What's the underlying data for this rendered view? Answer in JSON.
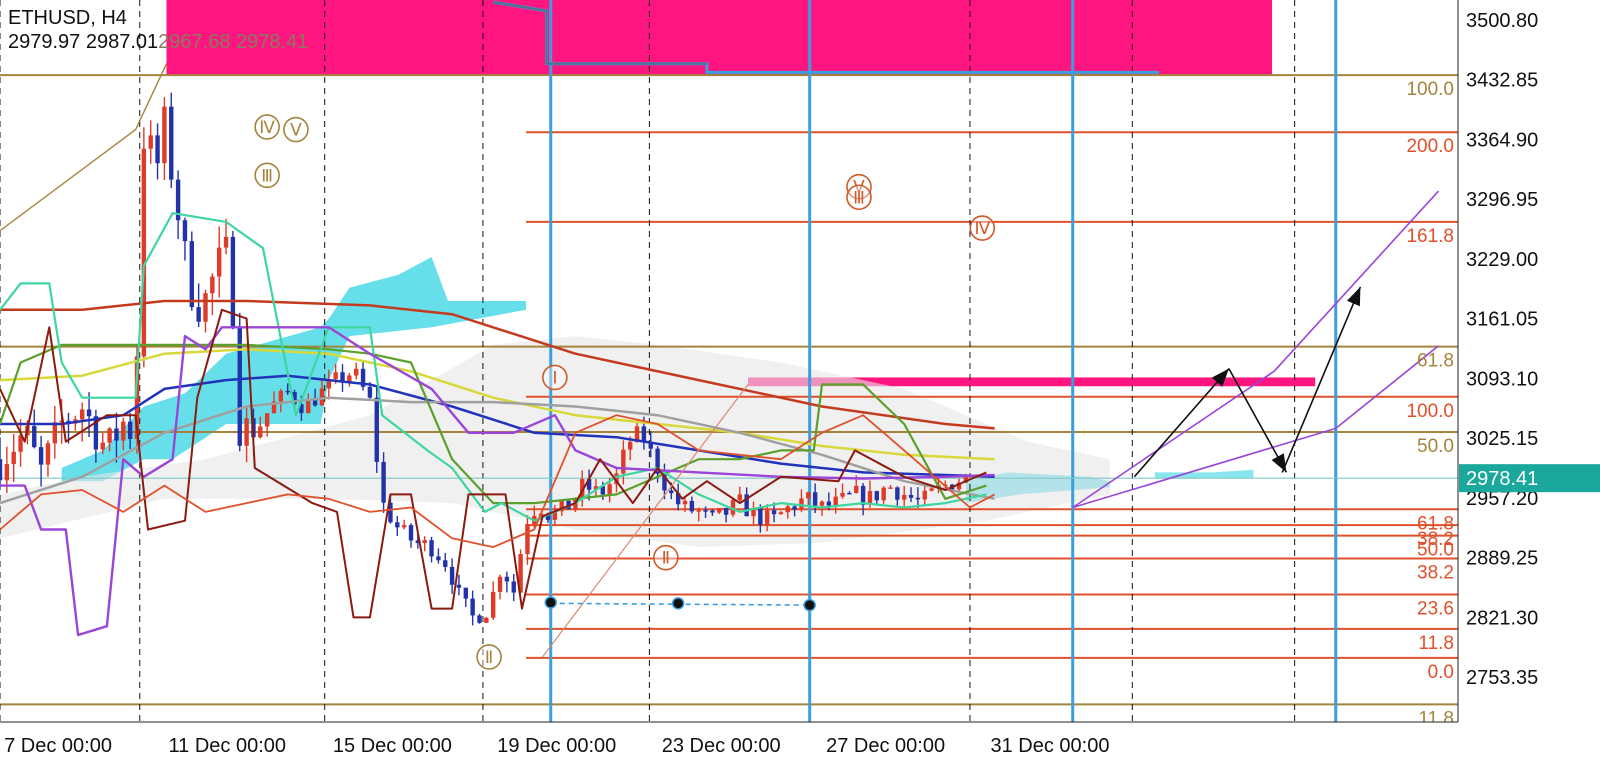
{
  "header": {
    "symbol": "ETHUSD, H4",
    "ohlc_dark": "2979.97 2987.01",
    "ohlc_light": "2967.68 2978.41"
  },
  "colors": {
    "magenta": "#ff1580",
    "fib_brown": "#a4843c",
    "fib_red": "#e0502a",
    "vline_blue": "#3a9ee0",
    "cloud_cyan": "#56dbe8",
    "price_tag": "#1aa79c",
    "purple": "#9a45d8",
    "dark_red": "#8b1a10",
    "ma_red": "#c43a1e",
    "ma_blue": "#2233bb",
    "ma_yellow": "#d8d83a",
    "ma_gray": "#a0a0a0",
    "green": "#5aa02a",
    "teal_line": "#3ed6a0"
  },
  "chart_data": {
    "type": "candlestick",
    "symbol": "ETHUSD",
    "timeframe": "H4",
    "ylim": [
      2710,
      3520
    ],
    "y_ticks": [
      3500.8,
      3432.85,
      3364.9,
      3296.95,
      3229.0,
      3161.05,
      3093.1,
      3025.15,
      2957.2,
      2889.25,
      2821.3,
      2753.35
    ],
    "x_ticks": [
      "7 Dec 00:00",
      "11 Dec 00:00",
      "15 Dec 00:00",
      "19 Dec 00:00",
      "23 Dec 00:00",
      "27 Dec 00:00",
      "31 Dec 00:00"
    ],
    "current_price": "2978.41",
    "fib_brown_levels": [
      {
        "label": "100.0",
        "price": 3437
      },
      {
        "label": "61.8",
        "price": 3128
      },
      {
        "label": "50.0",
        "price": 3031
      },
      {
        "label": "11.8",
        "price": 2721
      }
    ],
    "fib_red_levels": [
      {
        "label": "200.0",
        "price": 3372
      },
      {
        "label": "161.8",
        "price": 3270
      },
      {
        "label": "100.0",
        "price": 3071
      },
      {
        "label": "61.8",
        "price": 2943
      },
      {
        "label": "38.2",
        "price": 2925
      },
      {
        "label": "50.0",
        "price": 2913
      },
      {
        "label": "38.2",
        "price": 2887
      },
      {
        "label": "23.6",
        "price": 2846
      },
      {
        "label": "11.8",
        "price": 2807
      },
      {
        "label": "0.0",
        "price": 2774
      }
    ],
    "wave_labels": [
      {
        "text": "Ⅳ",
        "x_day": 13.5,
        "price": 3378
      },
      {
        "text": "Ⅴ",
        "x_day": 14.2,
        "price": 3375
      },
      {
        "text": "Ⅲ",
        "x_day": 13.5,
        "price": 3323
      },
      {
        "text": "Ⅰ",
        "x_day": 20.5,
        "price": 3093
      },
      {
        "text": "Ⅱ",
        "x_day": 18.9,
        "price": 2775
      },
      {
        "text": "Ⅱ",
        "x_day": 23.2,
        "price": 2888
      },
      {
        "text": "Ⅴ",
        "x_day": 27.9,
        "price": 3310
      },
      {
        "text": "Ⅲ",
        "x_day": 27.9,
        "price": 3298
      },
      {
        "text": "Ⅳ",
        "x_day": 30.9,
        "price": 3263
      }
    ]
  }
}
